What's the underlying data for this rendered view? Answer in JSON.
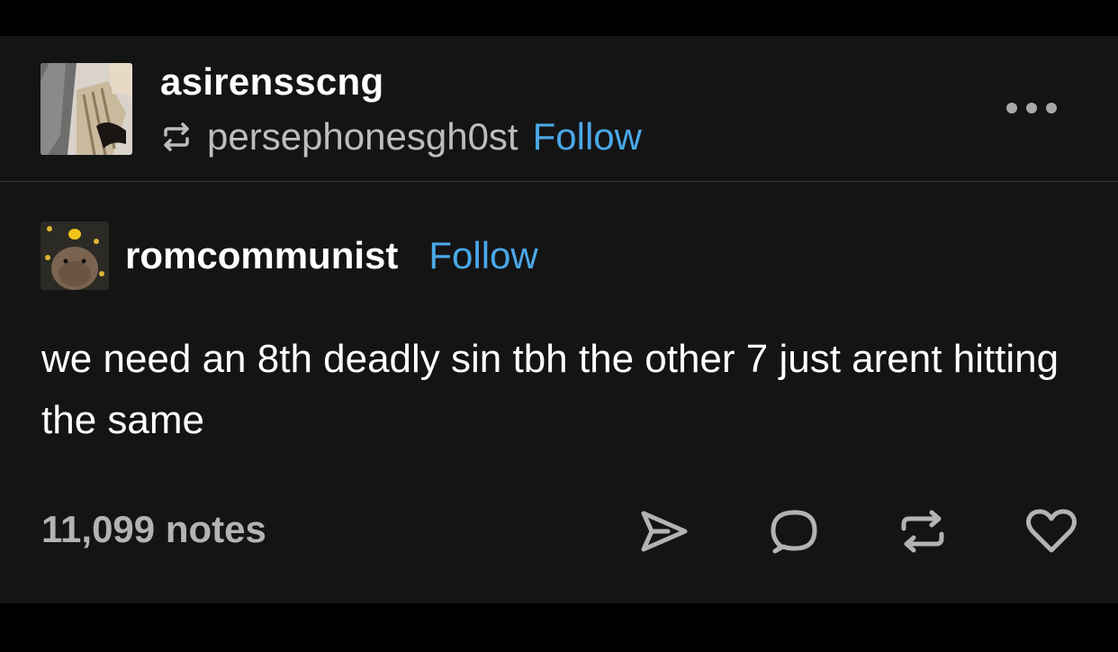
{
  "header": {
    "blog_name": "asirensscng",
    "reblog_source": "persephonesgh0st",
    "follow_label": "Follow",
    "more_icon": "more-horizontal-icon",
    "reblog_icon": "reblog-icon"
  },
  "post": {
    "author": "romcommunist",
    "follow_label": "Follow",
    "body": "we need an 8th deadly sin tbh the other 7 just arent hitting the same"
  },
  "footer": {
    "notes": "11,099 notes",
    "actions": [
      "share-icon",
      "reply-icon",
      "reblog-icon",
      "heart-icon"
    ]
  },
  "colors": {
    "background": "#141414",
    "link": "#4aa8e8",
    "text": "#ffffff",
    "muted": "#b3b3b3"
  }
}
